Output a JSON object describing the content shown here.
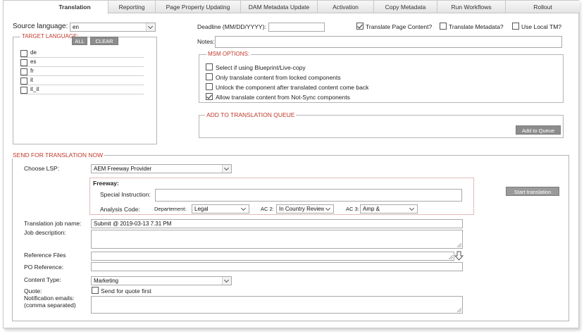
{
  "tabs": [
    {
      "label": "Translation",
      "active": true
    },
    {
      "label": "Reporting",
      "active": false
    },
    {
      "label": "Page Property Updating",
      "active": false
    },
    {
      "label": "DAM Metadata Update",
      "active": false
    },
    {
      "label": "Activation",
      "active": false
    },
    {
      "label": "Copy Metadata",
      "active": false
    },
    {
      "label": "Run Workflows",
      "active": false
    },
    {
      "label": "Rollout",
      "active": false
    }
  ],
  "source": {
    "label": "Source language:",
    "value": "en"
  },
  "target": {
    "legend": "TARGET LANGUAGE:",
    "all_label": "ALL",
    "clear_label": "CLEAR",
    "languages": [
      {
        "code": "de",
        "checked": false
      },
      {
        "code": "es",
        "checked": false
      },
      {
        "code": "fr",
        "checked": false
      },
      {
        "code": "it",
        "checked": false
      },
      {
        "code": "it_it",
        "checked": false
      }
    ]
  },
  "deadline": {
    "label": "Deadline (MM/DD/YYYY):",
    "value": ""
  },
  "options": {
    "translate_page_content": {
      "label": "Translate Page Content?",
      "checked": true
    },
    "translate_metadata": {
      "label": "Translate Metadata?",
      "checked": false
    },
    "use_local_tm": {
      "label": "Use Local TM?",
      "checked": false
    }
  },
  "notes": {
    "label": "Notes:",
    "value": ""
  },
  "msm": {
    "legend": "MSM OPTIONS:",
    "items": [
      {
        "label": "Select if using Blueprint/Live-copy",
        "checked": false
      },
      {
        "label": "Only translate content from locked components",
        "checked": false
      },
      {
        "label": "Unlock the component after translated content come back",
        "checked": false
      },
      {
        "label": "Allow translate content from Not-Sync components",
        "checked": true
      }
    ]
  },
  "queue": {
    "legend": "ADD TO TRANSLATION QUEUE",
    "button_label": "Add to Queue"
  },
  "send_now": {
    "legend": "SEND FOR TRANSLATION NOW",
    "lsp_label": "Choose LSP:",
    "lsp_value": "AEM Freeway Provider",
    "freeway_title": "Freeway:",
    "special_instruction_label": "Special Instruction:",
    "special_instruction_value": "",
    "analysis_code_label": "Analysis Code:",
    "departement_label": "Departement:",
    "departement_value": "Legal",
    "ac2_label": "AC 2:",
    "ac2_value": "In Country Review",
    "ac3_label": "AC 3:",
    "ac3_value": "Amp &",
    "start_button_label": "Start translation",
    "job_name_label": "Translation job name:",
    "job_name_value": "Submit @ 2019-03-13 7.31 PM",
    "job_description_label": "Job description:",
    "reference_files_label": "Reference Files",
    "po_reference_label": "PO Reference:",
    "content_type_label": "Content Type:",
    "content_type_value": "Marketing",
    "quote_label": "Quote:",
    "quote_checkbox_label": "Send for quote first",
    "quote_checked": false,
    "notification_label_1": "Notification emails:",
    "notification_label_2": "(comma separated)"
  }
}
